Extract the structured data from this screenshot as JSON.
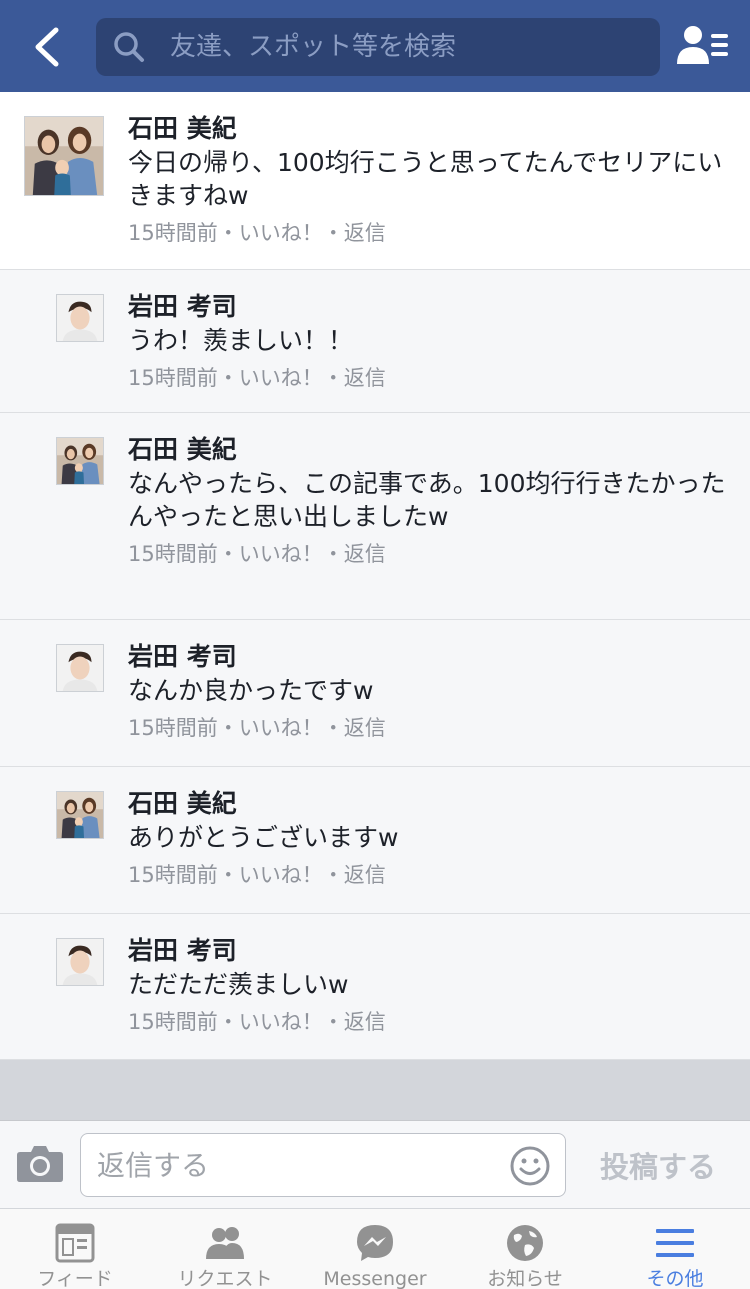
{
  "header": {
    "back_icon": "chevron-left-icon",
    "search_placeholder": "友達、スポット等を検索",
    "friends_icon": "friend-list-icon",
    "bg_color": "#3b5998"
  },
  "comments": [
    {
      "author": "石田 美紀",
      "text": "今日の帰り、100均行こうと思ってたんでセリアにいきますねw",
      "time": "15時間前",
      "like": "いいね！",
      "reply": "返信",
      "sep": "・",
      "avatar": "family-photo"
    },
    {
      "author": "岩田 考司",
      "text": "うわ！羨ましい！！",
      "time": "15時間前",
      "like": "いいね！",
      "reply": "返信",
      "sep": "・",
      "avatar": "man-photo"
    },
    {
      "author": "石田 美紀",
      "text": "なんやったら、この記事であ。100均行行きたかったんやったと思い出しましたw",
      "time": "15時間前",
      "like": "いいね！",
      "reply": "返信",
      "sep": "・",
      "avatar": "family-photo"
    },
    {
      "author": "岩田 考司",
      "text": "なんか良かったですw",
      "time": "15時間前",
      "like": "いいね！",
      "reply": "返信",
      "sep": "・",
      "avatar": "man-photo"
    },
    {
      "author": "石田 美紀",
      "text": "ありがとうございますw",
      "time": "15時間前",
      "like": "いいね！",
      "reply": "返信",
      "sep": "・",
      "avatar": "family-photo"
    },
    {
      "author": "岩田 考司",
      "text": "ただただ羨ましいw",
      "time": "15時間前",
      "like": "いいね！",
      "reply": "返信",
      "sep": "・",
      "avatar": "man-photo"
    }
  ],
  "reply_bar": {
    "camera_icon": "camera-icon",
    "placeholder": "返信する",
    "emoji_icon": "smiley-icon",
    "post_label": "投稿する"
  },
  "tabbar": {
    "tabs": [
      {
        "label": "フィード",
        "icon": "news-feed-icon",
        "active": false
      },
      {
        "label": "リクエスト",
        "icon": "friend-requests-icon",
        "active": false
      },
      {
        "label": "Messenger",
        "icon": "messenger-icon",
        "active": false
      },
      {
        "label": "お知らせ",
        "icon": "globe-icon",
        "active": false
      },
      {
        "label": "その他",
        "icon": "menu-icon",
        "active": true
      }
    ],
    "active_color": "#4a7ee0"
  }
}
